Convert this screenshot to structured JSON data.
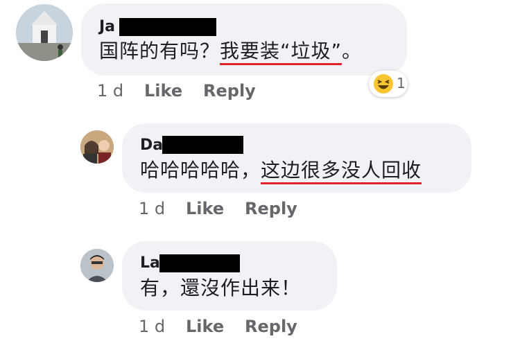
{
  "comments": [
    {
      "author": "Ja",
      "text_plain": "国阵的有吗？",
      "text_underlined": "我要装“垃圾”",
      "text_tail": "。",
      "time": "1 d",
      "like": "Like",
      "reply": "Reply",
      "reaction": {
        "icon": "laugh-emoji-icon",
        "count": "1"
      }
    },
    {
      "author": "Da",
      "text_plain": "哈哈哈哈哈，",
      "text_underlined": "这边很多没人回收",
      "text_tail": "",
      "time": "1 d",
      "like": "Like",
      "reply": "Reply"
    },
    {
      "author": "La",
      "text_plain": "有，還沒作出来！",
      "text_underlined": "",
      "text_tail": "",
      "time": "1 d",
      "like": "Like",
      "reply": "Reply"
    }
  ],
  "colors": {
    "bubble": "#f0f2f5",
    "underline": "#e2232b",
    "meta": "#65676b"
  }
}
